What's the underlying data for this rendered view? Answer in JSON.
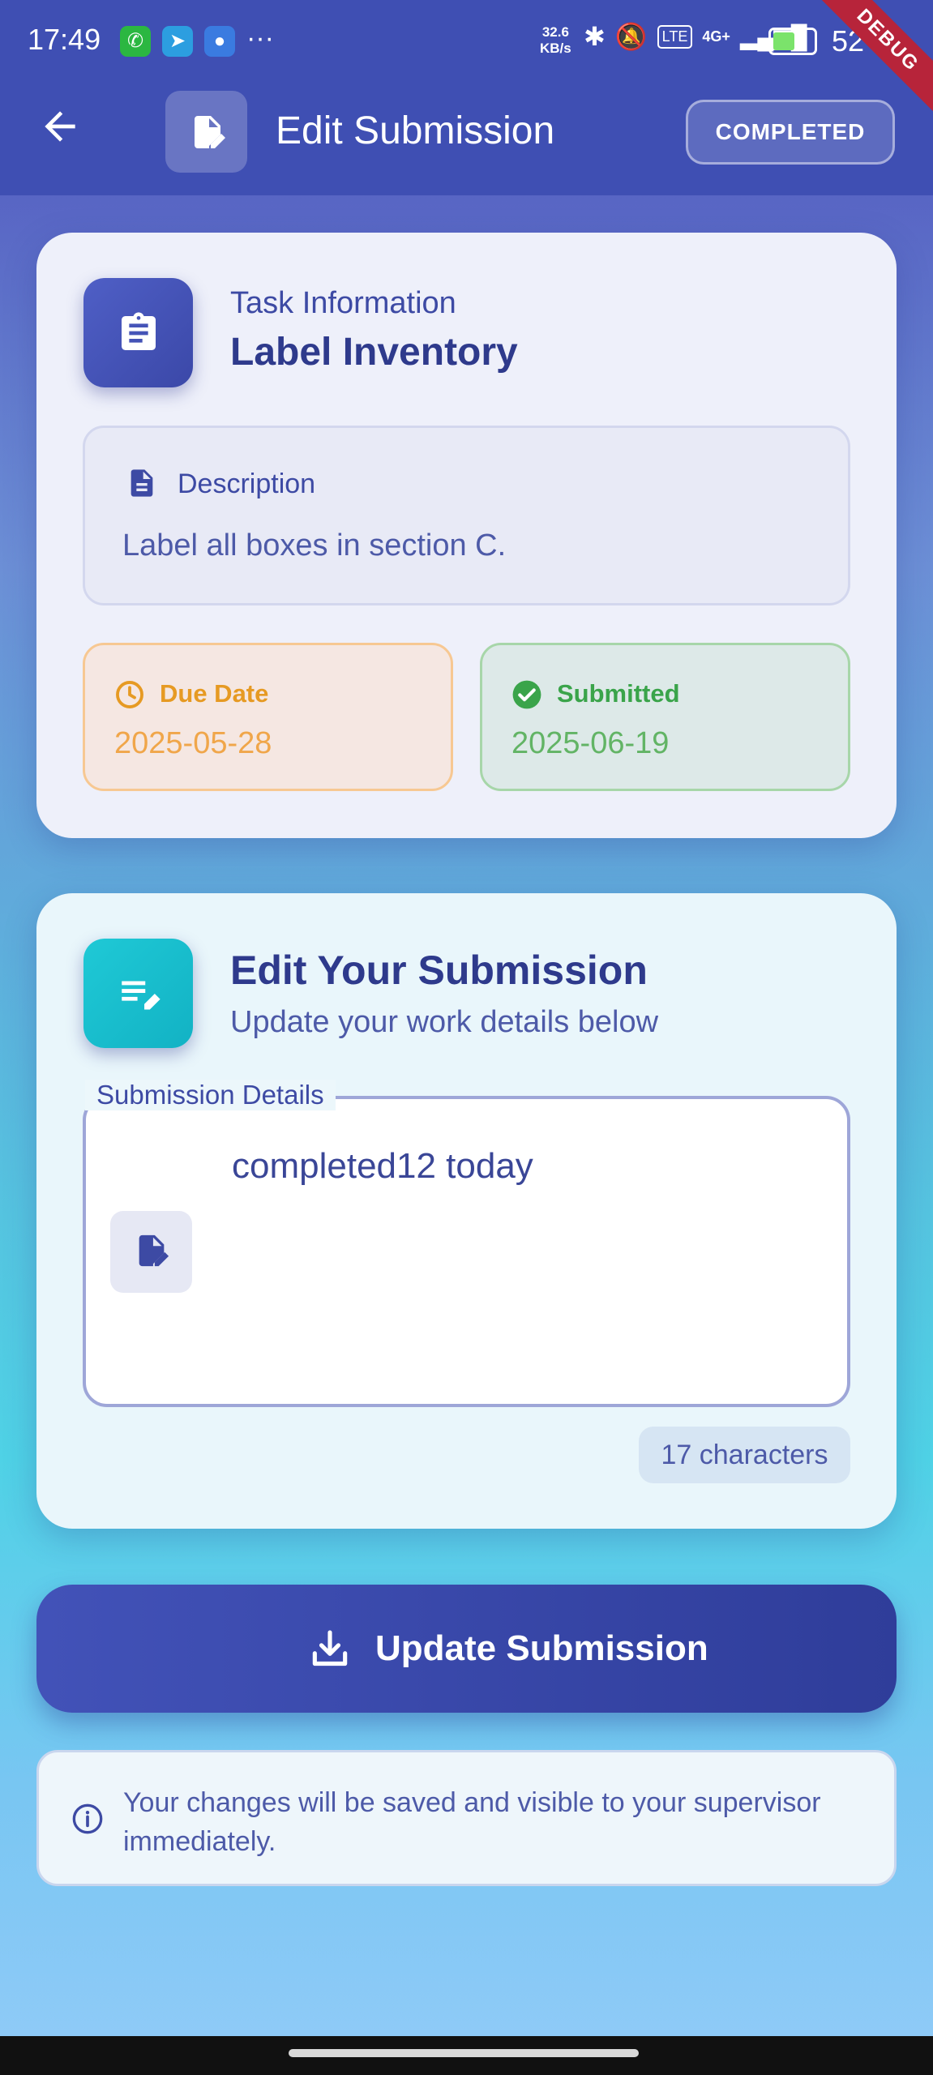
{
  "status_bar": {
    "time": "17:49",
    "more": "···",
    "net_speed_value": "32.6",
    "net_speed_unit": "KB/s",
    "network": "4G+",
    "battery": "52",
    "debug": "DEBUG"
  },
  "app_bar": {
    "title": "Edit Submission",
    "status_badge": "COMPLETED"
  },
  "task_card": {
    "subtitle": "Task Information",
    "title": "Label Inventory",
    "description_label": "Description",
    "description_text": "Label all boxes in section C.",
    "due_label": "Due Date",
    "due_value": "2025-05-28",
    "submitted_label": "Submitted",
    "submitted_value": "2025-06-19"
  },
  "edit_card": {
    "title": "Edit Your Submission",
    "subtitle": "Update your work details below",
    "field_label": "Submission Details",
    "field_value": "completed12 today",
    "char_count": "17 characters"
  },
  "update_button": {
    "label": "Update Submission"
  },
  "info": {
    "text": "Your changes will be saved and visible to your supervisor immediately."
  },
  "colors": {
    "primary": "#3f4fb3",
    "teal": "#1fc9d6",
    "due_orange": "#e69a23",
    "submitted_green": "#3aa44a"
  }
}
